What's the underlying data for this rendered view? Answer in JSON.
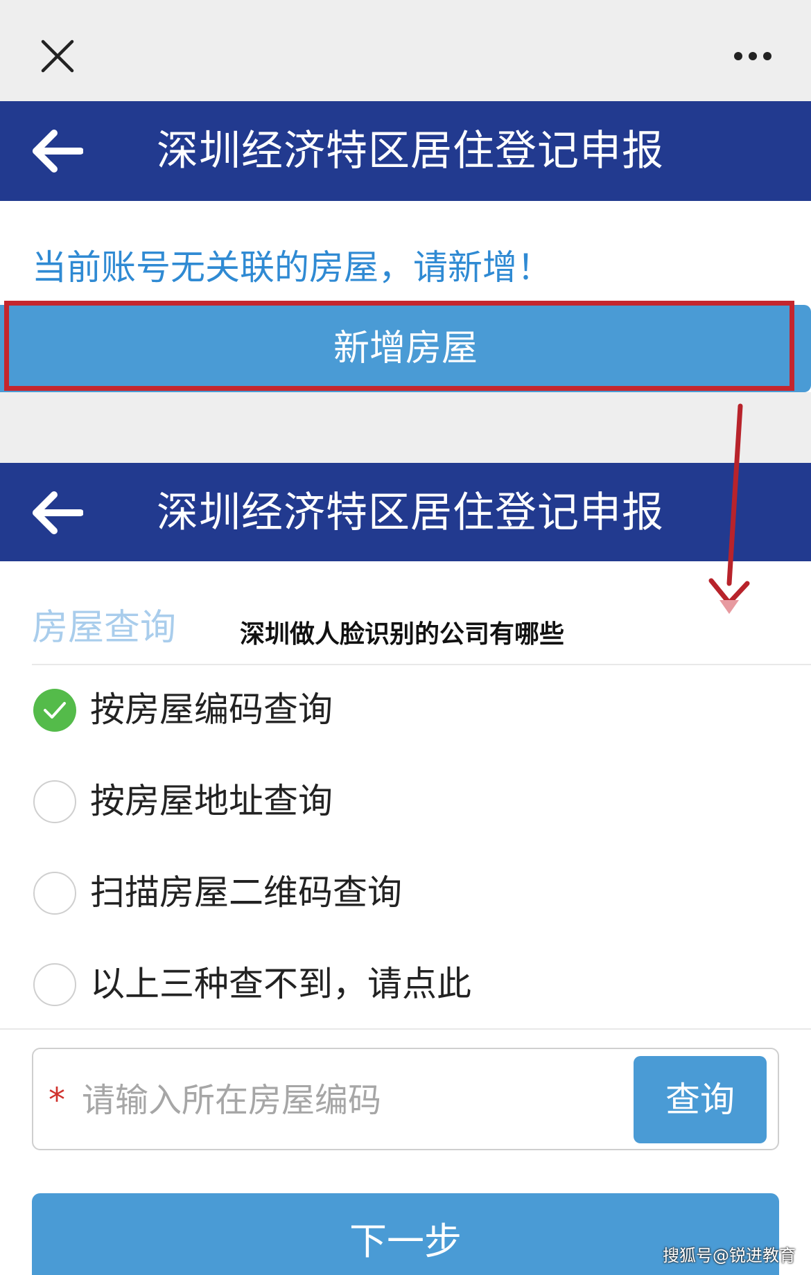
{
  "screen1": {
    "header": {
      "title": "深圳经济特区居住登记申报"
    },
    "notice": "当前账号无关联的房屋，请新增！",
    "add_house_button": "新增房屋"
  },
  "screen2": {
    "header": {
      "title": "深圳经济特区居住登记申报"
    },
    "section_title": "房屋查询",
    "overlay_caption": "深圳做人脸识别的公司有哪些",
    "options": [
      {
        "label": "按房屋编码查询",
        "checked": true
      },
      {
        "label": "按房屋地址查询",
        "checked": false
      },
      {
        "label": "扫描房屋二维码查询",
        "checked": false
      },
      {
        "label": "以上三种查不到，请点此",
        "checked": false
      }
    ],
    "search": {
      "required_mark": "*",
      "placeholder": "请输入所在房屋编码",
      "value": "",
      "button": "查询"
    },
    "next_button": "下一步"
  },
  "watermark": "搜狐号@锐进教育",
  "icons": {
    "close": "close-icon",
    "more": "more-icon",
    "back": "back-arrow-icon",
    "check": "checkmark-icon"
  },
  "colors": {
    "header_bg": "#223a8f",
    "button_bg": "#4a9bd5",
    "notice_text": "#2f8ad3",
    "annotation": "#c4262e",
    "checked": "#54bb4a"
  }
}
